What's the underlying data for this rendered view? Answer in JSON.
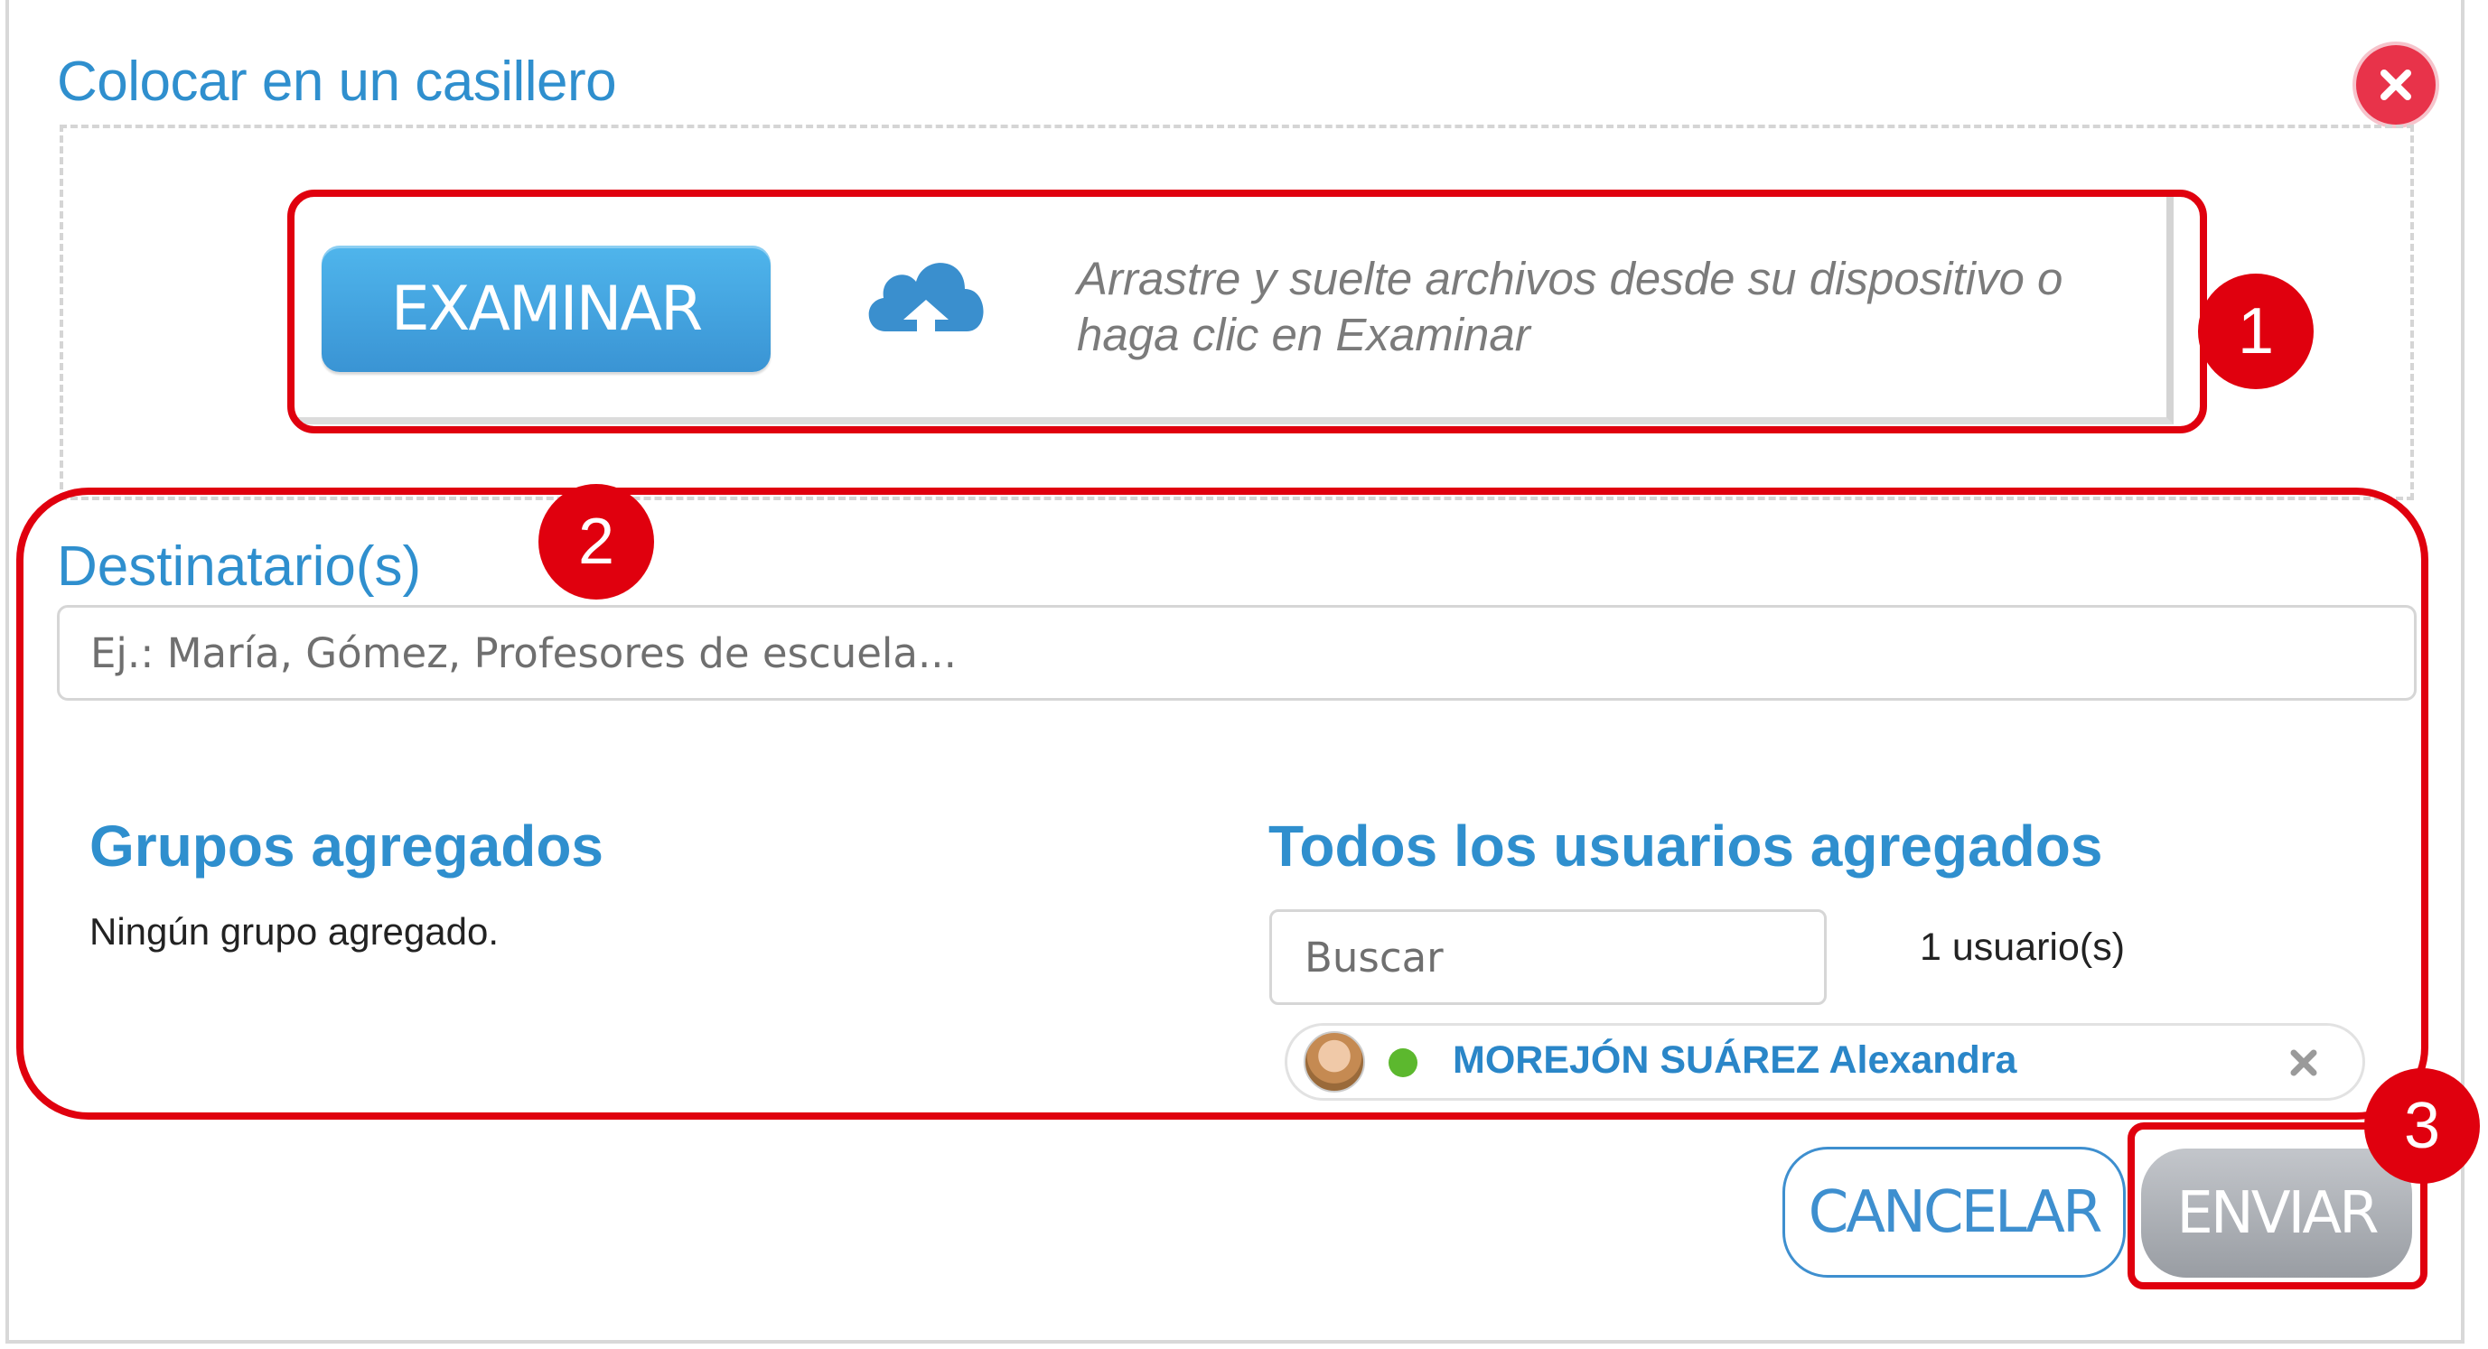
{
  "dialog": {
    "title": "Colocar en un casillero",
    "close_icon": "close-x-icon"
  },
  "upload": {
    "browse_label": "EXAMINAR",
    "cloud_icon": "cloud-upload-icon",
    "hint": "Arrastre y suelte archivos desde su dispositivo o haga clic en Examinar"
  },
  "recipients": {
    "label": "Destinatario(s)",
    "placeholder": "Ej.: María, Gómez, Profesores de escuela..."
  },
  "groups": {
    "title": "Grupos agregados",
    "empty_text": "Ningún grupo agregado."
  },
  "users": {
    "title": "Todos los usuarios agregados",
    "search_placeholder": "Buscar",
    "count": "1 usuario(s)",
    "list": [
      {
        "name": "MOREJÓN SUÁREZ Alexandra",
        "status": "online",
        "status_color": "#5cb82e"
      }
    ]
  },
  "actions": {
    "cancel_label": "CANCELAR",
    "send_label": "ENVIAR"
  },
  "annotations": {
    "color": "#e0000e",
    "markers": [
      "1",
      "2",
      "3"
    ]
  }
}
